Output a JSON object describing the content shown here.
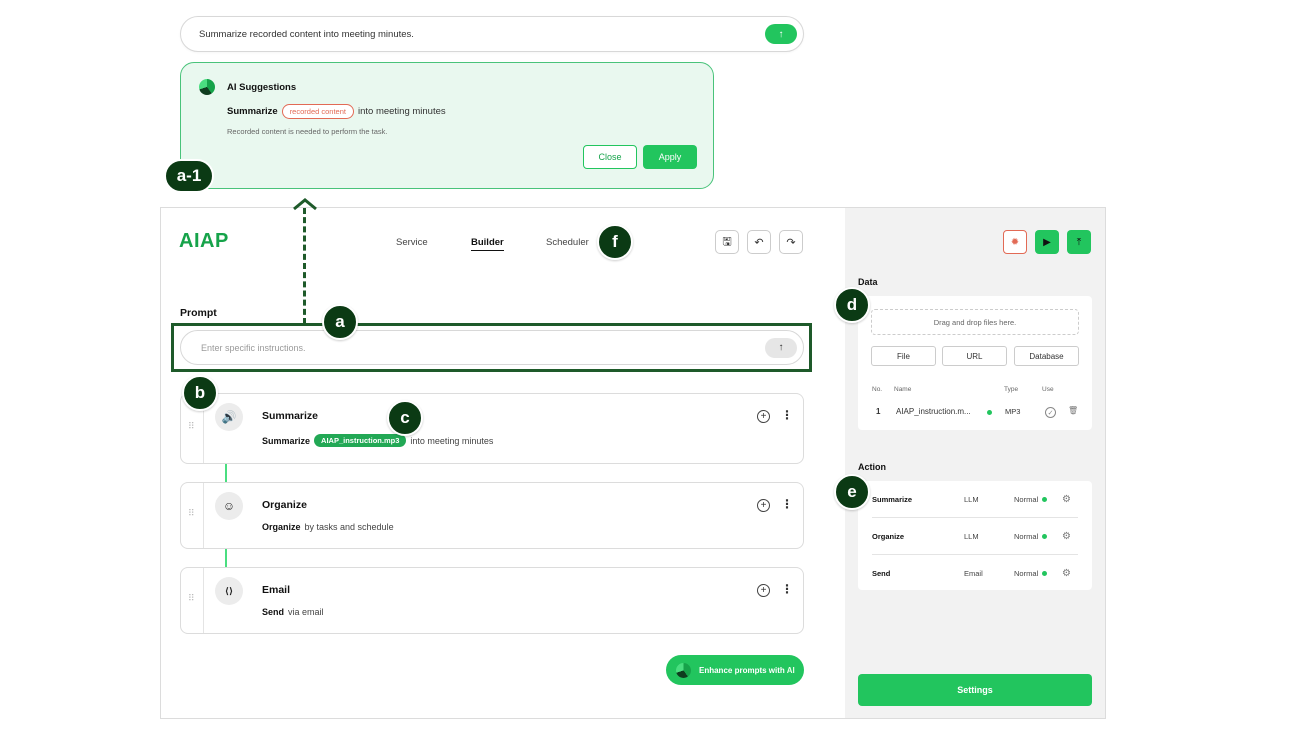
{
  "top_prompt": {
    "text": "Summarize recorded content into meeting minutes.",
    "send_icon": "↑"
  },
  "ai_panel": {
    "title": "AI Suggestions",
    "line_bold": "Summarize",
    "line_pill": "recorded content",
    "line_rest": "into meeting minutes",
    "note": "Recorded content is needed to perform the task.",
    "close_label": "Close",
    "apply_label": "Apply"
  },
  "annotations": {
    "a1": "a-1",
    "a": "a",
    "b": "b",
    "c": "c",
    "d": "d",
    "e": "e",
    "f": "f"
  },
  "header": {
    "logo": "AIAP",
    "nav": [
      "Service",
      "Builder",
      "Scheduler"
    ],
    "active_nav": "Builder",
    "tools": {
      "save": "🖫",
      "undo": "↶",
      "redo": "↷"
    }
  },
  "prompt": {
    "label": "Prompt",
    "placeholder": "Enter specific instructions.",
    "send_icon": "↑"
  },
  "steps": [
    {
      "title": "Summarize",
      "desc_bold": "Summarize",
      "pill": "AIAP_instruction.mp3",
      "desc_rest": "into meeting minutes",
      "icon": "🔊"
    },
    {
      "title": "Organize",
      "desc_bold": "Organize",
      "pill": "",
      "desc_rest": "by tasks and schedule",
      "icon": "☺"
    },
    {
      "title": "Email",
      "desc_bold": "Send",
      "pill": "",
      "desc_rest": "via email",
      "icon": "⟨⟩"
    }
  ],
  "step_controls": {
    "plus": "+",
    "more": "⋮",
    "grip": "⠿"
  },
  "enhance": {
    "label": "Enhance prompts with",
    "ai": "AI"
  },
  "right_toolbar": {
    "bug": "✹",
    "play": "▶",
    "deploy": "⤒"
  },
  "data_section": {
    "title": "Data",
    "drop_text": "Drag and drop files here.",
    "sources": [
      "File",
      "URL",
      "Database"
    ],
    "columns": {
      "no": "No.",
      "name": "Name",
      "type": "Type",
      "use": "Use"
    },
    "rows": [
      {
        "no": "1",
        "name": "AIAP_instruction.m...",
        "type": "MP3",
        "use_icon": "✓",
        "delete_icon": "🗑"
      }
    ]
  },
  "action_section": {
    "title": "Action",
    "rows": [
      {
        "name": "Summarize",
        "type": "LLM",
        "status": "Normal"
      },
      {
        "name": "Organize",
        "type": "LLM",
        "status": "Normal"
      },
      {
        "name": "Send",
        "type": "Email",
        "status": "Normal"
      }
    ],
    "gear_icon": "⚙"
  },
  "settings_label": "Settings",
  "colors": {
    "accent": "#22c55e",
    "dark_annot": "#0b3a14",
    "warn": "#e26a55"
  }
}
